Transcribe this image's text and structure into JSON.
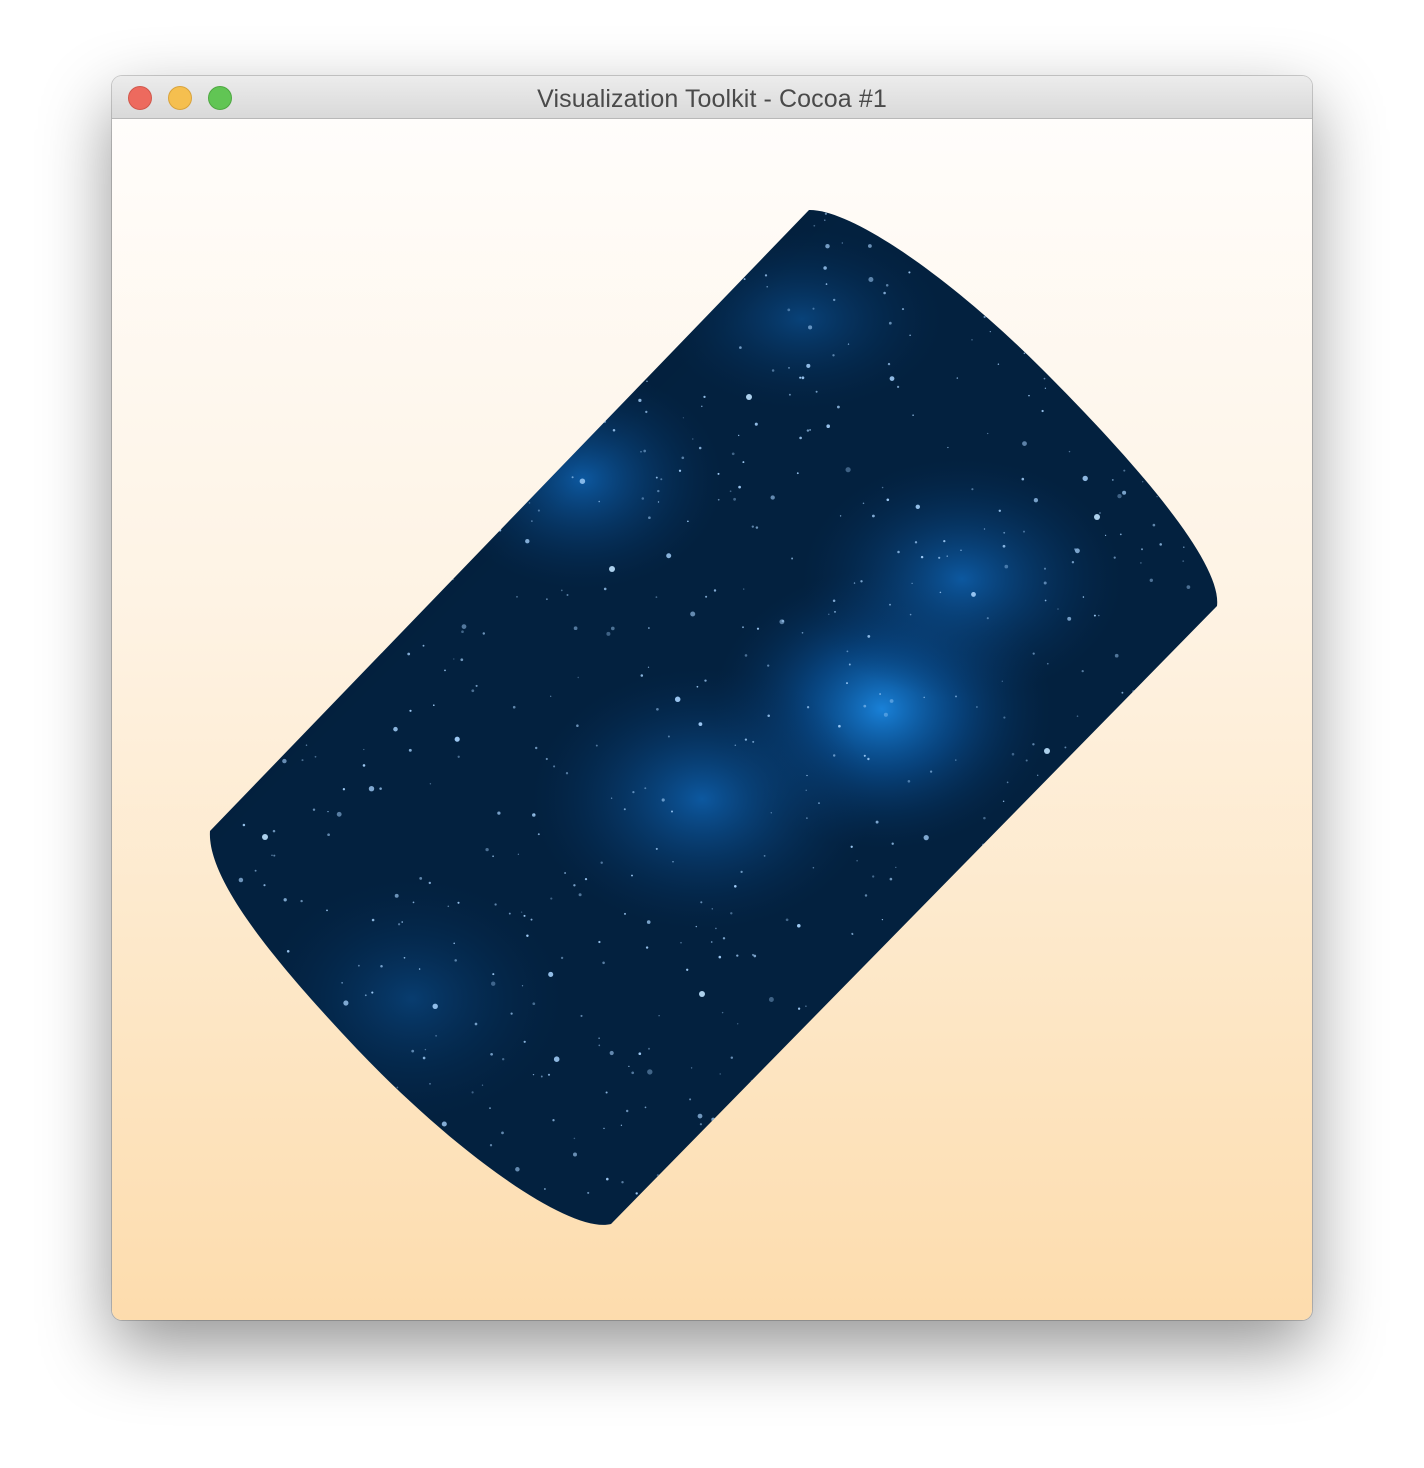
{
  "window": {
    "title": "Visualization Toolkit - Cocoa #1"
  },
  "titlebar_buttons": {
    "close": "close-button",
    "minimize": "minimize-button",
    "zoom": "zoom-button"
  },
  "colors": {
    "background_top": "#fffdfb",
    "background_bottom": "#fddcad",
    "texture_base": "#02152d",
    "texture_glow": "#1a7fd6",
    "star": "#a8d4ff"
  },
  "scene": {
    "object": "textured-cylinder",
    "texture": "starfield"
  }
}
